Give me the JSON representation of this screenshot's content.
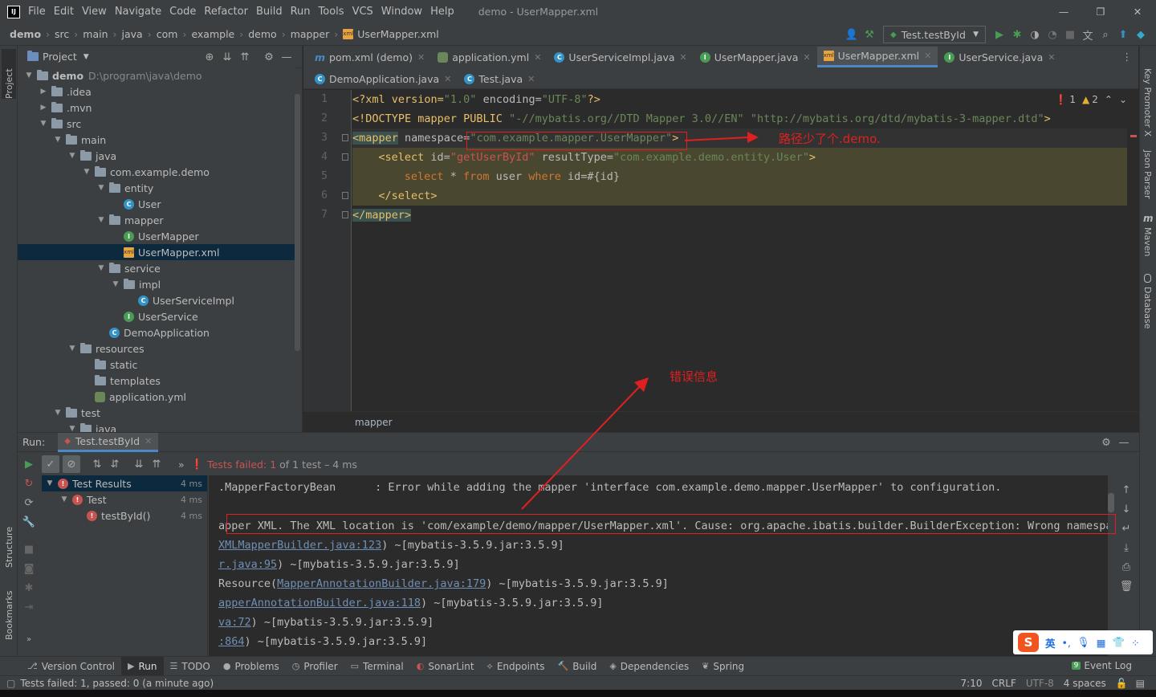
{
  "menubar": {
    "items": [
      "File",
      "Edit",
      "View",
      "Navigate",
      "Code",
      "Refactor",
      "Build",
      "Run",
      "Tools",
      "VCS",
      "Window",
      "Help"
    ],
    "title": "demo - UserMapper.xml"
  },
  "breadcrumb": [
    "demo",
    "src",
    "main",
    "java",
    "com",
    "example",
    "demo",
    "mapper",
    "UserMapper.xml"
  ],
  "run_config": "Test.testById",
  "project_panel": {
    "title": "Project",
    "root_name": "demo",
    "root_path": "D:\\program\\java\\demo",
    "items": [
      {
        "label": "demo",
        "depth": 0,
        "icon": "folder"
      },
      {
        "label": ".idea",
        "depth": 1,
        "icon": "folder"
      },
      {
        "label": ".mvn",
        "depth": 1,
        "icon": "folder"
      },
      {
        "label": "src",
        "depth": 1,
        "icon": "folder"
      },
      {
        "label": "main",
        "depth": 2,
        "icon": "folder"
      },
      {
        "label": "java",
        "depth": 3,
        "icon": "folder"
      },
      {
        "label": "com.example.demo",
        "depth": 4,
        "icon": "package"
      },
      {
        "label": "entity",
        "depth": 5,
        "icon": "package"
      },
      {
        "label": "User",
        "depth": 6,
        "icon": "class"
      },
      {
        "label": "mapper",
        "depth": 5,
        "icon": "package"
      },
      {
        "label": "UserMapper",
        "depth": 6,
        "icon": "interface"
      },
      {
        "label": "UserMapper.xml",
        "depth": 6,
        "icon": "xml"
      },
      {
        "label": "service",
        "depth": 5,
        "icon": "package"
      },
      {
        "label": "impl",
        "depth": 6,
        "icon": "package"
      },
      {
        "label": "UserServiceImpl",
        "depth": 7,
        "icon": "class"
      },
      {
        "label": "UserService",
        "depth": 6,
        "icon": "interface"
      },
      {
        "label": "DemoApplication",
        "depth": 5,
        "icon": "springclass"
      },
      {
        "label": "resources",
        "depth": 3,
        "icon": "folder"
      },
      {
        "label": "static",
        "depth": 4,
        "icon": "folder"
      },
      {
        "label": "templates",
        "depth": 4,
        "icon": "folder"
      },
      {
        "label": "application.yml",
        "depth": 4,
        "icon": "yml"
      },
      {
        "label": "test",
        "depth": 2,
        "icon": "folder"
      },
      {
        "label": "java",
        "depth": 3,
        "icon": "folder"
      }
    ]
  },
  "editor_tabs_row1": [
    {
      "label": "pom.xml (demo)",
      "icon": "maven"
    },
    {
      "label": "application.yml",
      "icon": "yml"
    },
    {
      "label": "UserServiceImpl.java",
      "icon": "class"
    },
    {
      "label": "UserMapper.java",
      "icon": "interface"
    },
    {
      "label": "UserMapper.xml",
      "icon": "xml",
      "active": true
    },
    {
      "label": "UserService.java",
      "icon": "interface"
    }
  ],
  "editor_tabs_row2": [
    {
      "label": "DemoApplication.java",
      "icon": "springclass"
    },
    {
      "label": "Test.java",
      "icon": "class"
    }
  ],
  "inspections": {
    "errors": "1",
    "warnings": "2"
  },
  "code": {
    "line1": {
      "a": "<?xml version=",
      "b": "\"1.0\"",
      "c": " encoding=",
      "d": "\"UTF-8\"",
      "e": "?>"
    },
    "line2": {
      "a": "<!DOCTYPE mapper PUBLIC ",
      "b": "\"-//mybatis.org//DTD Mapper 3.0//EN\"",
      "c": " ",
      "d": "\"http://mybatis.org/dtd/mybatis-3-mapper.dtd\"",
      "e": ">"
    },
    "line3": {
      "a": "<mapper",
      "b": " namespace=",
      "c": "\"com.example.mapper.UserMapper\"",
      "d": ">"
    },
    "line4": {
      "a": "<select",
      "b": " id=",
      "c": "\"getUserById\"",
      "d": " resultType=",
      "e": "\"com.example.demo.entity.User\"",
      "f": ">"
    },
    "line5": {
      "a": "select",
      "b": " * ",
      "c": "from",
      "d": " user ",
      "e": "where",
      "f": " id=#{id}"
    },
    "line6": {
      "a": "</select>"
    },
    "line7": {
      "a": "</mapper>"
    },
    "line_numbers": [
      "1",
      "2",
      "3",
      "4",
      "5",
      "6",
      "7"
    ]
  },
  "annotation_namespace": "路径少了个.demo.",
  "annotation_error": "错误信息",
  "editor_breadcrumb": "mapper",
  "run_panel": {
    "label": "Run:",
    "tab": "Test.testById",
    "status_prefix": "Tests failed:",
    "status_count": "1",
    "status_suffix": "of 1 test – 4 ms",
    "tree": [
      {
        "label": "Test Results",
        "time": "4 ms",
        "depth": 0
      },
      {
        "label": "Test",
        "time": "4 ms",
        "depth": 1
      },
      {
        "label": "testById()",
        "time": "4 ms",
        "depth": 2
      }
    ]
  },
  "console": {
    "l1": ".MapperFactoryBean      : Error while adding the mapper 'interface com.example.demo.mapper.UserMapper' to configuration.",
    "l2": "apper XML. The XML location is 'com/example/demo/mapper/UserMapper.xml'. Cause: org.apache.ibatis.builder.BuilderException: Wrong namespace.",
    "l3a": "XMLMapperBuilder.java:123",
    "l3b": ") ~[mybatis-3.5.9.jar:3.5.9]",
    "l4a": "r.java:95",
    "l4b": ") ~[mybatis-3.5.9.jar:3.5.9]",
    "l5a": "Resource(",
    "l5b": "MapperAnnotationBuilder.java:179",
    "l5c": ") ~[mybatis-3.5.9.jar:3.5.9]",
    "l6a": "apperAnnotationBuilder.java:118",
    "l6b": ") ~[mybatis-3.5.9.jar:3.5.9]",
    "l7a": "va:72",
    "l7b": ") ~[mybatis-3.5.9.jar:3.5.9]",
    "l8a": ":864",
    "l8b": ") ~[mybatis-3.5.9.jar:3.5.9]"
  },
  "bottom_tools": [
    "Version Control",
    "Run",
    "TODO",
    "Problems",
    "Profiler",
    "Terminal",
    "SonarLint",
    "Endpoints",
    "Build",
    "Dependencies",
    "Spring"
  ],
  "event_log": "Event Log",
  "event_log_count": "9",
  "status_bar": {
    "message": "Tests failed: 1, passed: 0 (a minute ago)",
    "position": "7:10",
    "line_sep": "CRLF",
    "encoding": "UTF-8",
    "indent": "4 spaces"
  },
  "right_sidebar": [
    "Key Promoter X",
    "Json Parser",
    "Maven",
    "Database"
  ],
  "left_sidebar": [
    "Project",
    "Structure",
    "Bookmarks"
  ],
  "ime": {
    "lang": "英"
  }
}
